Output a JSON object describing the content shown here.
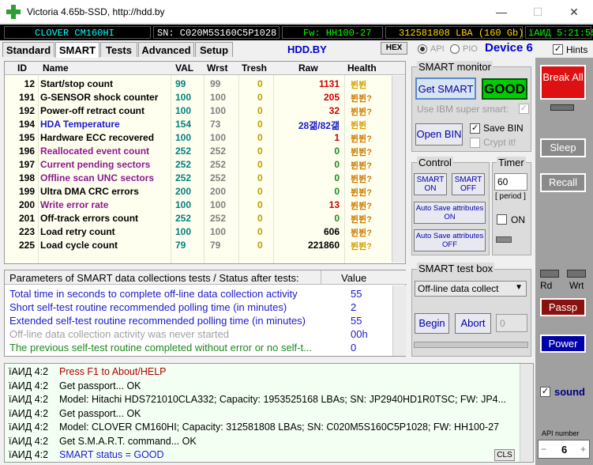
{
  "window": {
    "title": "Victoria 4.65b-SSD, http://hdd.by",
    "minimize": "—",
    "maximize": "☐",
    "close": "✕"
  },
  "info": {
    "model": "CLOVER  CM160HI",
    "serial": "SN: C020M5S160C5P1028",
    "firmware": "Fw: HH100-27",
    "lba": "312581808 LBA (160 Gb)",
    "clock": "ïАИД 5:21:55"
  },
  "tabs": [
    "Standard",
    "SMART",
    "Tests",
    "Advanced",
    "Setup"
  ],
  "active_tab": "SMART",
  "site": "HDD.BY",
  "hex_label": "HEX",
  "api_label": "API",
  "pio_label": "PIO",
  "device_label": "Device 6",
  "hints_label": "Hints",
  "smart_table": {
    "headers": {
      "id": "ID",
      "name": "Name",
      "val": "VAL",
      "wrst": "Wrst",
      "tresh": "Tresh",
      "raw": "Raw",
      "health": "Health"
    },
    "rows": [
      {
        "id": "12",
        "name": "Start/stop count",
        "val": "99",
        "wrst": "99",
        "tresh": "0",
        "raw": "1131",
        "health": "뷘뷘",
        "name_color": "#000000",
        "health_color": "#d4a000"
      },
      {
        "id": "191",
        "name": "G-SENSOR shock counter",
        "val": "100",
        "wrst": "100",
        "tresh": "0",
        "raw": "205",
        "health": "뷘뷘?",
        "name_color": "#000000",
        "health_color": "#cc7a00"
      },
      {
        "id": "192",
        "name": "Power-off retract count",
        "val": "100",
        "wrst": "100",
        "tresh": "0",
        "raw": "32",
        "health": "뷘뷘?",
        "name_color": "#000000",
        "health_color": "#cc7a00"
      },
      {
        "id": "194",
        "name": "HDA Temperature",
        "val": "154",
        "wrst": "73",
        "tresh": "0",
        "raw": "28갦/82갦",
        "health": "뷘뷘",
        "name_color": "#1a1acc",
        "health_color": "#d4a000"
      },
      {
        "id": "195",
        "name": "Hardware ECC recovered",
        "val": "100",
        "wrst": "100",
        "tresh": "0",
        "raw": "1",
        "health": "뷘뷘?",
        "name_color": "#000000",
        "health_color": "#cc7a00"
      },
      {
        "id": "196",
        "name": "Reallocated event count",
        "val": "252",
        "wrst": "252",
        "tresh": "0",
        "raw": "0",
        "health": "뷘뷘?",
        "name_color": "#8b1a8b",
        "health_color": "#cc7a00"
      },
      {
        "id": "197",
        "name": "Current pending sectors",
        "val": "252",
        "wrst": "252",
        "tresh": "0",
        "raw": "0",
        "health": "뷘뷘?",
        "name_color": "#8b1a8b",
        "health_color": "#cc7a00"
      },
      {
        "id": "198",
        "name": "Offline scan UNC sectors",
        "val": "252",
        "wrst": "252",
        "tresh": "0",
        "raw": "0",
        "health": "뷘뷘?",
        "name_color": "#8b1a8b",
        "health_color": "#cc7a00"
      },
      {
        "id": "199",
        "name": "Ultra DMA CRC errors",
        "val": "200",
        "wrst": "200",
        "tresh": "0",
        "raw": "0",
        "health": "뷘뷘?",
        "name_color": "#000000",
        "health_color": "#cc7a00"
      },
      {
        "id": "200",
        "name": "Write error rate",
        "val": "100",
        "wrst": "100",
        "tresh": "0",
        "raw": "13",
        "health": "뷘뷘?",
        "name_color": "#8b1a8b",
        "health_color": "#cc7a00"
      },
      {
        "id": "201",
        "name": "Off-track errors count",
        "val": "252",
        "wrst": "252",
        "tresh": "0",
        "raw": "0",
        "health": "뷘뷘?",
        "name_color": "#000000",
        "health_color": "#cc7a00"
      },
      {
        "id": "223",
        "name": "Load retry count",
        "val": "100",
        "wrst": "100",
        "tresh": "0",
        "raw": "606",
        "health": "뷘뷘?",
        "name_color": "#000000",
        "health_color": "#cc7a00"
      },
      {
        "id": "225",
        "name": "Load cycle count",
        "val": "79",
        "wrst": "79",
        "tresh": "0",
        "raw": "221860",
        "health": "뷘뷘?",
        "name_color": "#000000",
        "health_color": "#d4a000"
      }
    ]
  },
  "params": {
    "header_name": "Parameters of SMART data collections tests / Status after tests:",
    "header_value": "Value",
    "rows": [
      {
        "name": "Total time in seconds to complete off-line data collection activity",
        "value": "55",
        "color": "#1a1acc"
      },
      {
        "name": "Short self-test routine recommended polling time (in minutes)",
        "value": "2",
        "color": "#1a1acc"
      },
      {
        "name": "Extended self-test routine recommended polling time (in minutes)",
        "value": "55",
        "color": "#1a1acc"
      },
      {
        "name": "Off-line data collection activity was never started",
        "value": "00h",
        "color": "#a0a0a0"
      },
      {
        "name": "The previous self-test routine completed without error or no self-t...",
        "value": "0",
        "color": "#1a8a1a"
      }
    ]
  },
  "smart_monitor": {
    "title": "SMART monitor",
    "get_smart": "Get SMART",
    "status": "GOOD",
    "use_ibm": "Use IBM super smart:",
    "open_bin": "Open BIN",
    "save_bin": "Save BIN",
    "crypt": "Crypt it!"
  },
  "control": {
    "title": "Control",
    "smart_on": "SMART ON",
    "smart_off": "SMART OFF",
    "autosave_on": "Auto Save attributes ON",
    "autosave_off": "Auto Save attributes OFF"
  },
  "timer": {
    "title": "Timer",
    "value": "60",
    "period": "[ period ]",
    "on_label": "ON"
  },
  "test_box": {
    "title": "SMART test box",
    "selected": "Off-line data collect",
    "begin": "Begin",
    "abort": "Abort",
    "number": "0"
  },
  "right_panel": {
    "break_all": "Break All",
    "sleep": "Sleep",
    "recall": "Recall",
    "rd": "Rd",
    "wrt": "Wrt",
    "passp": "Passp",
    "power": "Power",
    "sound": "sound",
    "api_number_label": "API number",
    "api_number": "6"
  },
  "log": {
    "cls": "CLS",
    "rows": [
      {
        "time": "ïАИД 4:2",
        "msg": "Press F1 to About/HELP",
        "color": "#b00000"
      },
      {
        "time": "ïАИД 4:2",
        "msg": "Get passport... OK",
        "color": "#000000"
      },
      {
        "time": "ïАИД 4:2",
        "msg": "Model: Hitachi HDS721010CLA332; Capacity: 1953525168 LBAs; SN: JP2940HD1R0TSC; FW: JP4...",
        "color": "#000000"
      },
      {
        "time": "ïАИД 4:2",
        "msg": "Get passport... OK",
        "color": "#000000"
      },
      {
        "time": "ïАИД 4:2",
        "msg": "Model: CLOVER  CM160HI; Capacity: 312581808 LBAs; SN: C020M5S160C5P1028; FW: HH100-27",
        "color": "#000000"
      },
      {
        "time": "ïАИД 4:2",
        "msg": "Get S.M.A.R.T. command... OK",
        "color": "#000000"
      },
      {
        "time": "ïАИД 4:2",
        "msg": "SMART status = GOOD",
        "color": "#1a1acc"
      }
    ]
  },
  "colors": {
    "good_bg": "#00cc00",
    "break_bg": "#dd1111",
    "passp_bg": "#8b1010",
    "power_bg": "#0000aa",
    "panel_bg": "#a0a0a0"
  }
}
